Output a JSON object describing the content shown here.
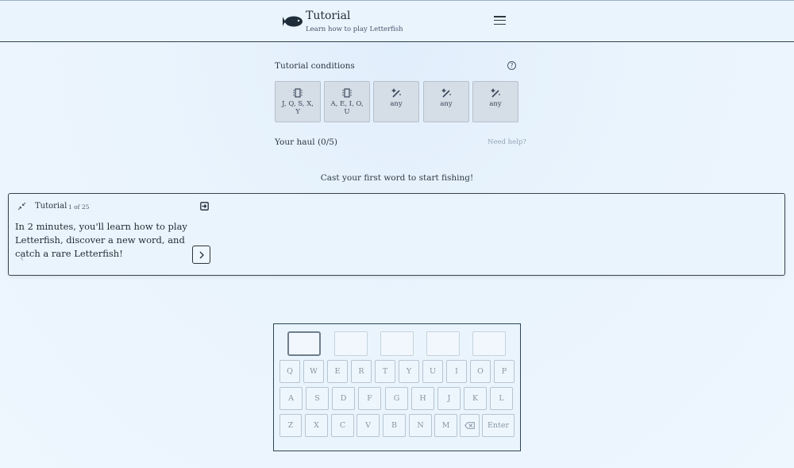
{
  "header": {
    "title": "Tutorial",
    "subtitle": "Learn how to play Letterfish",
    "icons": {
      "logo": "fish-icon",
      "menu": "hamburger-menu-icon"
    }
  },
  "conditions": {
    "label": "Tutorial conditions",
    "help_icon": "question-circle-icon",
    "cards": [
      {
        "icon": "letter-tile-icon",
        "text": "J, Q, S, X, Y"
      },
      {
        "icon": "letter-tile-icon",
        "text": "A, E, I, O, U"
      },
      {
        "icon": "magic-wand-icon",
        "text": "any"
      },
      {
        "icon": "magic-wand-icon",
        "text": "any"
      },
      {
        "icon": "magic-wand-icon",
        "text": "any"
      }
    ]
  },
  "haul": {
    "label": "Your haul (0/5)",
    "help_link": "Need help?"
  },
  "cast_message": "Cast your first word to start fishing!",
  "tutorial": {
    "title": "Tutorial",
    "step": "1 of 25",
    "body": "In 2 minutes, you'll learn how to play Letterfish, discover a new word, and catch a rare Letterfish!",
    "icons": {
      "collapse": "collapse-arrows-icon",
      "exit": "exit-icon",
      "prev": "chevron-left-icon",
      "next": "chevron-right-icon"
    }
  },
  "keyboard": {
    "row1": [
      "Q",
      "W",
      "E",
      "R",
      "T",
      "Y",
      "U",
      "I",
      "O",
      "P"
    ],
    "row2": [
      "A",
      "S",
      "D",
      "F",
      "G",
      "H",
      "J",
      "K",
      "L"
    ],
    "row3": [
      "Z",
      "X",
      "C",
      "V",
      "B",
      "N",
      "M"
    ],
    "backspace_icon": "backspace-icon",
    "enter_label": "Enter"
  },
  "colors": {
    "background": "#eaf4fd",
    "header_border": "#2f4151",
    "card_bg": "#d5dde6",
    "accent_dark": "#1f2d3a"
  }
}
